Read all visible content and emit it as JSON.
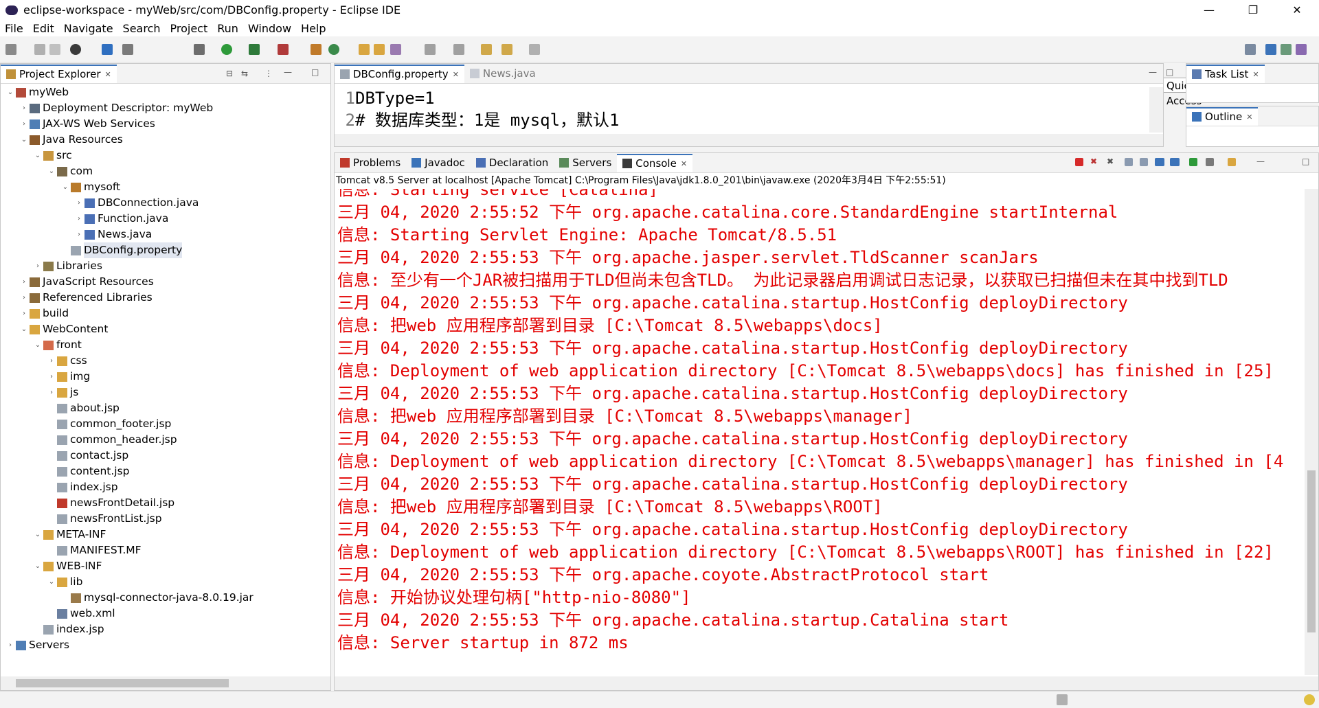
{
  "window": {
    "title": "eclipse-workspace - myWeb/src/com/DBConfig.property - Eclipse IDE",
    "min": "—",
    "max": "❐",
    "close": "✕"
  },
  "menu": [
    "File",
    "Edit",
    "Navigate",
    "Search",
    "Project",
    "Run",
    "Window",
    "Help"
  ],
  "quick_access": "Quick Access",
  "project_explorer": {
    "tab_label": "Project Explorer",
    "items": [
      {
        "label": "myWeb",
        "indent": 0,
        "arrow": "⌄",
        "icon": "#b34a3a"
      },
      {
        "label": "Deployment Descriptor: myWeb",
        "indent": 1,
        "arrow": "›",
        "icon": "#5a6b7f"
      },
      {
        "label": "JAX-WS Web Services",
        "indent": 1,
        "arrow": "›",
        "icon": "#4f7eb5"
      },
      {
        "label": "Java Resources",
        "indent": 1,
        "arrow": "⌄",
        "icon": "#8b5a2b"
      },
      {
        "label": "src",
        "indent": 2,
        "arrow": "⌄",
        "icon": "#c8963e"
      },
      {
        "label": "com",
        "indent": 3,
        "arrow": "⌄",
        "icon": "#7a6a4a"
      },
      {
        "label": "mysoft",
        "indent": 4,
        "arrow": "⌄",
        "icon": "#b97a2a"
      },
      {
        "label": "DBConnection.java",
        "indent": 5,
        "arrow": "›",
        "icon": "#4a6fb5"
      },
      {
        "label": "Function.java",
        "indent": 5,
        "arrow": "›",
        "icon": "#4a6fb5"
      },
      {
        "label": "News.java",
        "indent": 5,
        "arrow": "›",
        "icon": "#4a6fb5"
      },
      {
        "label": "DBConfig.property",
        "indent": 4,
        "arrow": "",
        "icon": "#9aa4b0",
        "selected": true
      },
      {
        "label": "Libraries",
        "indent": 2,
        "arrow": "›",
        "icon": "#8a7a4a"
      },
      {
        "label": "JavaScript Resources",
        "indent": 1,
        "arrow": "›",
        "icon": "#8a6a3a"
      },
      {
        "label": "Referenced Libraries",
        "indent": 1,
        "arrow": "›",
        "icon": "#8a6a3a"
      },
      {
        "label": "build",
        "indent": 1,
        "arrow": "›",
        "icon": "#d9a640"
      },
      {
        "label": "WebContent",
        "indent": 1,
        "arrow": "⌄",
        "icon": "#d9a640"
      },
      {
        "label": "front",
        "indent": 2,
        "arrow": "⌄",
        "icon": "#d46a4a"
      },
      {
        "label": "css",
        "indent": 3,
        "arrow": "›",
        "icon": "#d9a640"
      },
      {
        "label": "img",
        "indent": 3,
        "arrow": "›",
        "icon": "#d9a640"
      },
      {
        "label": "js",
        "indent": 3,
        "arrow": "›",
        "icon": "#d9a640"
      },
      {
        "label": "about.jsp",
        "indent": 3,
        "arrow": "",
        "icon": "#9aa4b0"
      },
      {
        "label": "common_footer.jsp",
        "indent": 3,
        "arrow": "",
        "icon": "#9aa4b0"
      },
      {
        "label": "common_header.jsp",
        "indent": 3,
        "arrow": "",
        "icon": "#9aa4b0"
      },
      {
        "label": "contact.jsp",
        "indent": 3,
        "arrow": "",
        "icon": "#9aa4b0"
      },
      {
        "label": "content.jsp",
        "indent": 3,
        "arrow": "",
        "icon": "#9aa4b0"
      },
      {
        "label": "index.jsp",
        "indent": 3,
        "arrow": "",
        "icon": "#9aa4b0"
      },
      {
        "label": "newsFrontDetail.jsp",
        "indent": 3,
        "arrow": "",
        "icon": "#c0392b"
      },
      {
        "label": "newsFrontList.jsp",
        "indent": 3,
        "arrow": "",
        "icon": "#9aa4b0"
      },
      {
        "label": "META-INF",
        "indent": 2,
        "arrow": "⌄",
        "icon": "#d9a640"
      },
      {
        "label": "MANIFEST.MF",
        "indent": 3,
        "arrow": "",
        "icon": "#9aa4b0"
      },
      {
        "label": "WEB-INF",
        "indent": 2,
        "arrow": "⌄",
        "icon": "#d9a640"
      },
      {
        "label": "lib",
        "indent": 3,
        "arrow": "⌄",
        "icon": "#d9a640"
      },
      {
        "label": "mysql-connector-java-8.0.19.jar",
        "indent": 4,
        "arrow": "",
        "icon": "#9a7a4a"
      },
      {
        "label": "web.xml",
        "indent": 3,
        "arrow": "",
        "icon": "#6a7fa0"
      },
      {
        "label": "index.jsp",
        "indent": 2,
        "arrow": "",
        "icon": "#9aa4b0"
      },
      {
        "label": "Servers",
        "indent": 0,
        "arrow": "›",
        "icon": "#4f7eb5"
      }
    ]
  },
  "editor": {
    "tabs": [
      {
        "label": "DBConfig.property",
        "active": true
      },
      {
        "label": "News.java",
        "active": false
      }
    ],
    "lines": [
      {
        "num": "1",
        "text": "DBType=1"
      },
      {
        "num": "2",
        "text": "# 数据库类型：1是 mysql，默认1"
      }
    ]
  },
  "task_list": {
    "tab_label": "Task List"
  },
  "outline": {
    "tab_label": "Outline"
  },
  "bottom": {
    "tabs": [
      "Problems",
      "Javadoc",
      "Declaration",
      "Servers",
      "Console"
    ],
    "active_tab": "Console",
    "status": "Tomcat v8.5 Server at localhost [Apache Tomcat] C:\\Program Files\\Java\\jdk1.8.0_201\\bin\\javaw.exe (2020年3月4日 下午2:55:51)",
    "lines": [
      "信息: Starting service [Catalina]",
      "三月 04, 2020 2:55:52 下午 org.apache.catalina.core.StandardEngine startInternal",
      "信息: Starting Servlet Engine: Apache Tomcat/8.5.51",
      "三月 04, 2020 2:55:53 下午 org.apache.jasper.servlet.TldScanner scanJars",
      "信息: 至少有一个JAR被扫描用于TLD但尚未包含TLD。 为此记录器启用调试日志记录，以获取已扫描但未在其中找到TLD",
      "三月 04, 2020 2:55:53 下午 org.apache.catalina.startup.HostConfig deployDirectory",
      "信息: 把web 应用程序部署到目录 [C:\\Tomcat 8.5\\webapps\\docs]",
      "三月 04, 2020 2:55:53 下午 org.apache.catalina.startup.HostConfig deployDirectory",
      "信息: Deployment of web application directory [C:\\Tomcat 8.5\\webapps\\docs] has finished in [25]",
      "三月 04, 2020 2:55:53 下午 org.apache.catalina.startup.HostConfig deployDirectory",
      "信息: 把web 应用程序部署到目录 [C:\\Tomcat 8.5\\webapps\\manager]",
      "三月 04, 2020 2:55:53 下午 org.apache.catalina.startup.HostConfig deployDirectory",
      "信息: Deployment of web application directory [C:\\Tomcat 8.5\\webapps\\manager] has finished in [4",
      "三月 04, 2020 2:55:53 下午 org.apache.catalina.startup.HostConfig deployDirectory",
      "信息: 把web 应用程序部署到目录 [C:\\Tomcat 8.5\\webapps\\ROOT]",
      "三月 04, 2020 2:55:53 下午 org.apache.catalina.startup.HostConfig deployDirectory",
      "信息: Deployment of web application directory [C:\\Tomcat 8.5\\webapps\\ROOT] has finished in [22]",
      "三月 04, 2020 2:55:53 下午 org.apache.coyote.AbstractProtocol start",
      "信息: 开始协议处理句柄[\"http-nio-8080\"]",
      "三月 04, 2020 2:55:53 下午 org.apache.catalina.startup.Catalina start",
      "信息: Server startup in 872 ms"
    ]
  },
  "colors": {
    "console_text": "#e30000",
    "active_tab_border": "#3b73b9"
  }
}
